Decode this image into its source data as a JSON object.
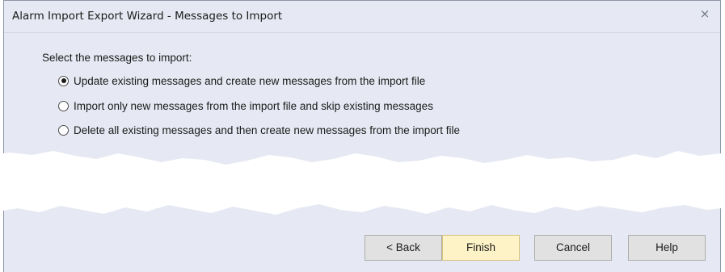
{
  "window": {
    "title": "Alarm Import Export Wizard - Messages to Import",
    "close_glyph": "×"
  },
  "content": {
    "prompt": "Select the messages to import:",
    "options": [
      {
        "label": "Update existing messages and create new messages from the import file",
        "selected": true
      },
      {
        "label": "Import only new messages from the import file and skip existing messages",
        "selected": false
      },
      {
        "label": "Delete all existing messages and then create new messages from the import file",
        "selected": false
      }
    ]
  },
  "footer": {
    "back_label": "< Back",
    "finish_label": "Finish",
    "cancel_label": "Cancel",
    "help_label": "Help"
  }
}
